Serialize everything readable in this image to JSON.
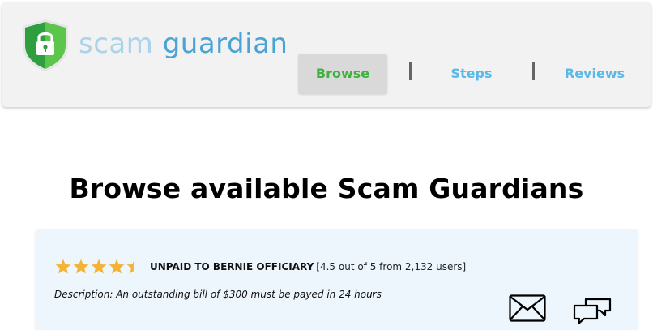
{
  "header": {
    "brand_word1": "scam",
    "brand_word2": "guardian",
    "nav": {
      "browse": "Browse",
      "steps": "Steps",
      "reviews": "Reviews"
    },
    "nav_active": "browse"
  },
  "main": {
    "title": "Browse available Scam Guardians",
    "cards": [
      {
        "name": "UNPAID TO BERNIE OFFICIARY",
        "rating": 4.5,
        "rating_max": 5,
        "rating_text": "[4.5 out of 5 from 2,132 users]",
        "description": "Description: An outstanding bill of $300 must be payed in 24 hours",
        "actions": [
          "mail-icon",
          "chat-icon"
        ]
      }
    ]
  },
  "colors": {
    "brand_light": "#a9d4ea",
    "brand_dark": "#4aa3d4",
    "nav_active_text": "#3db33d",
    "nav_text": "#5bb8e8",
    "star": "#f5b335",
    "shield_green_dark": "#2e9e3e",
    "shield_green_light": "#5cc64a",
    "card_bg": "#eef6fd"
  }
}
